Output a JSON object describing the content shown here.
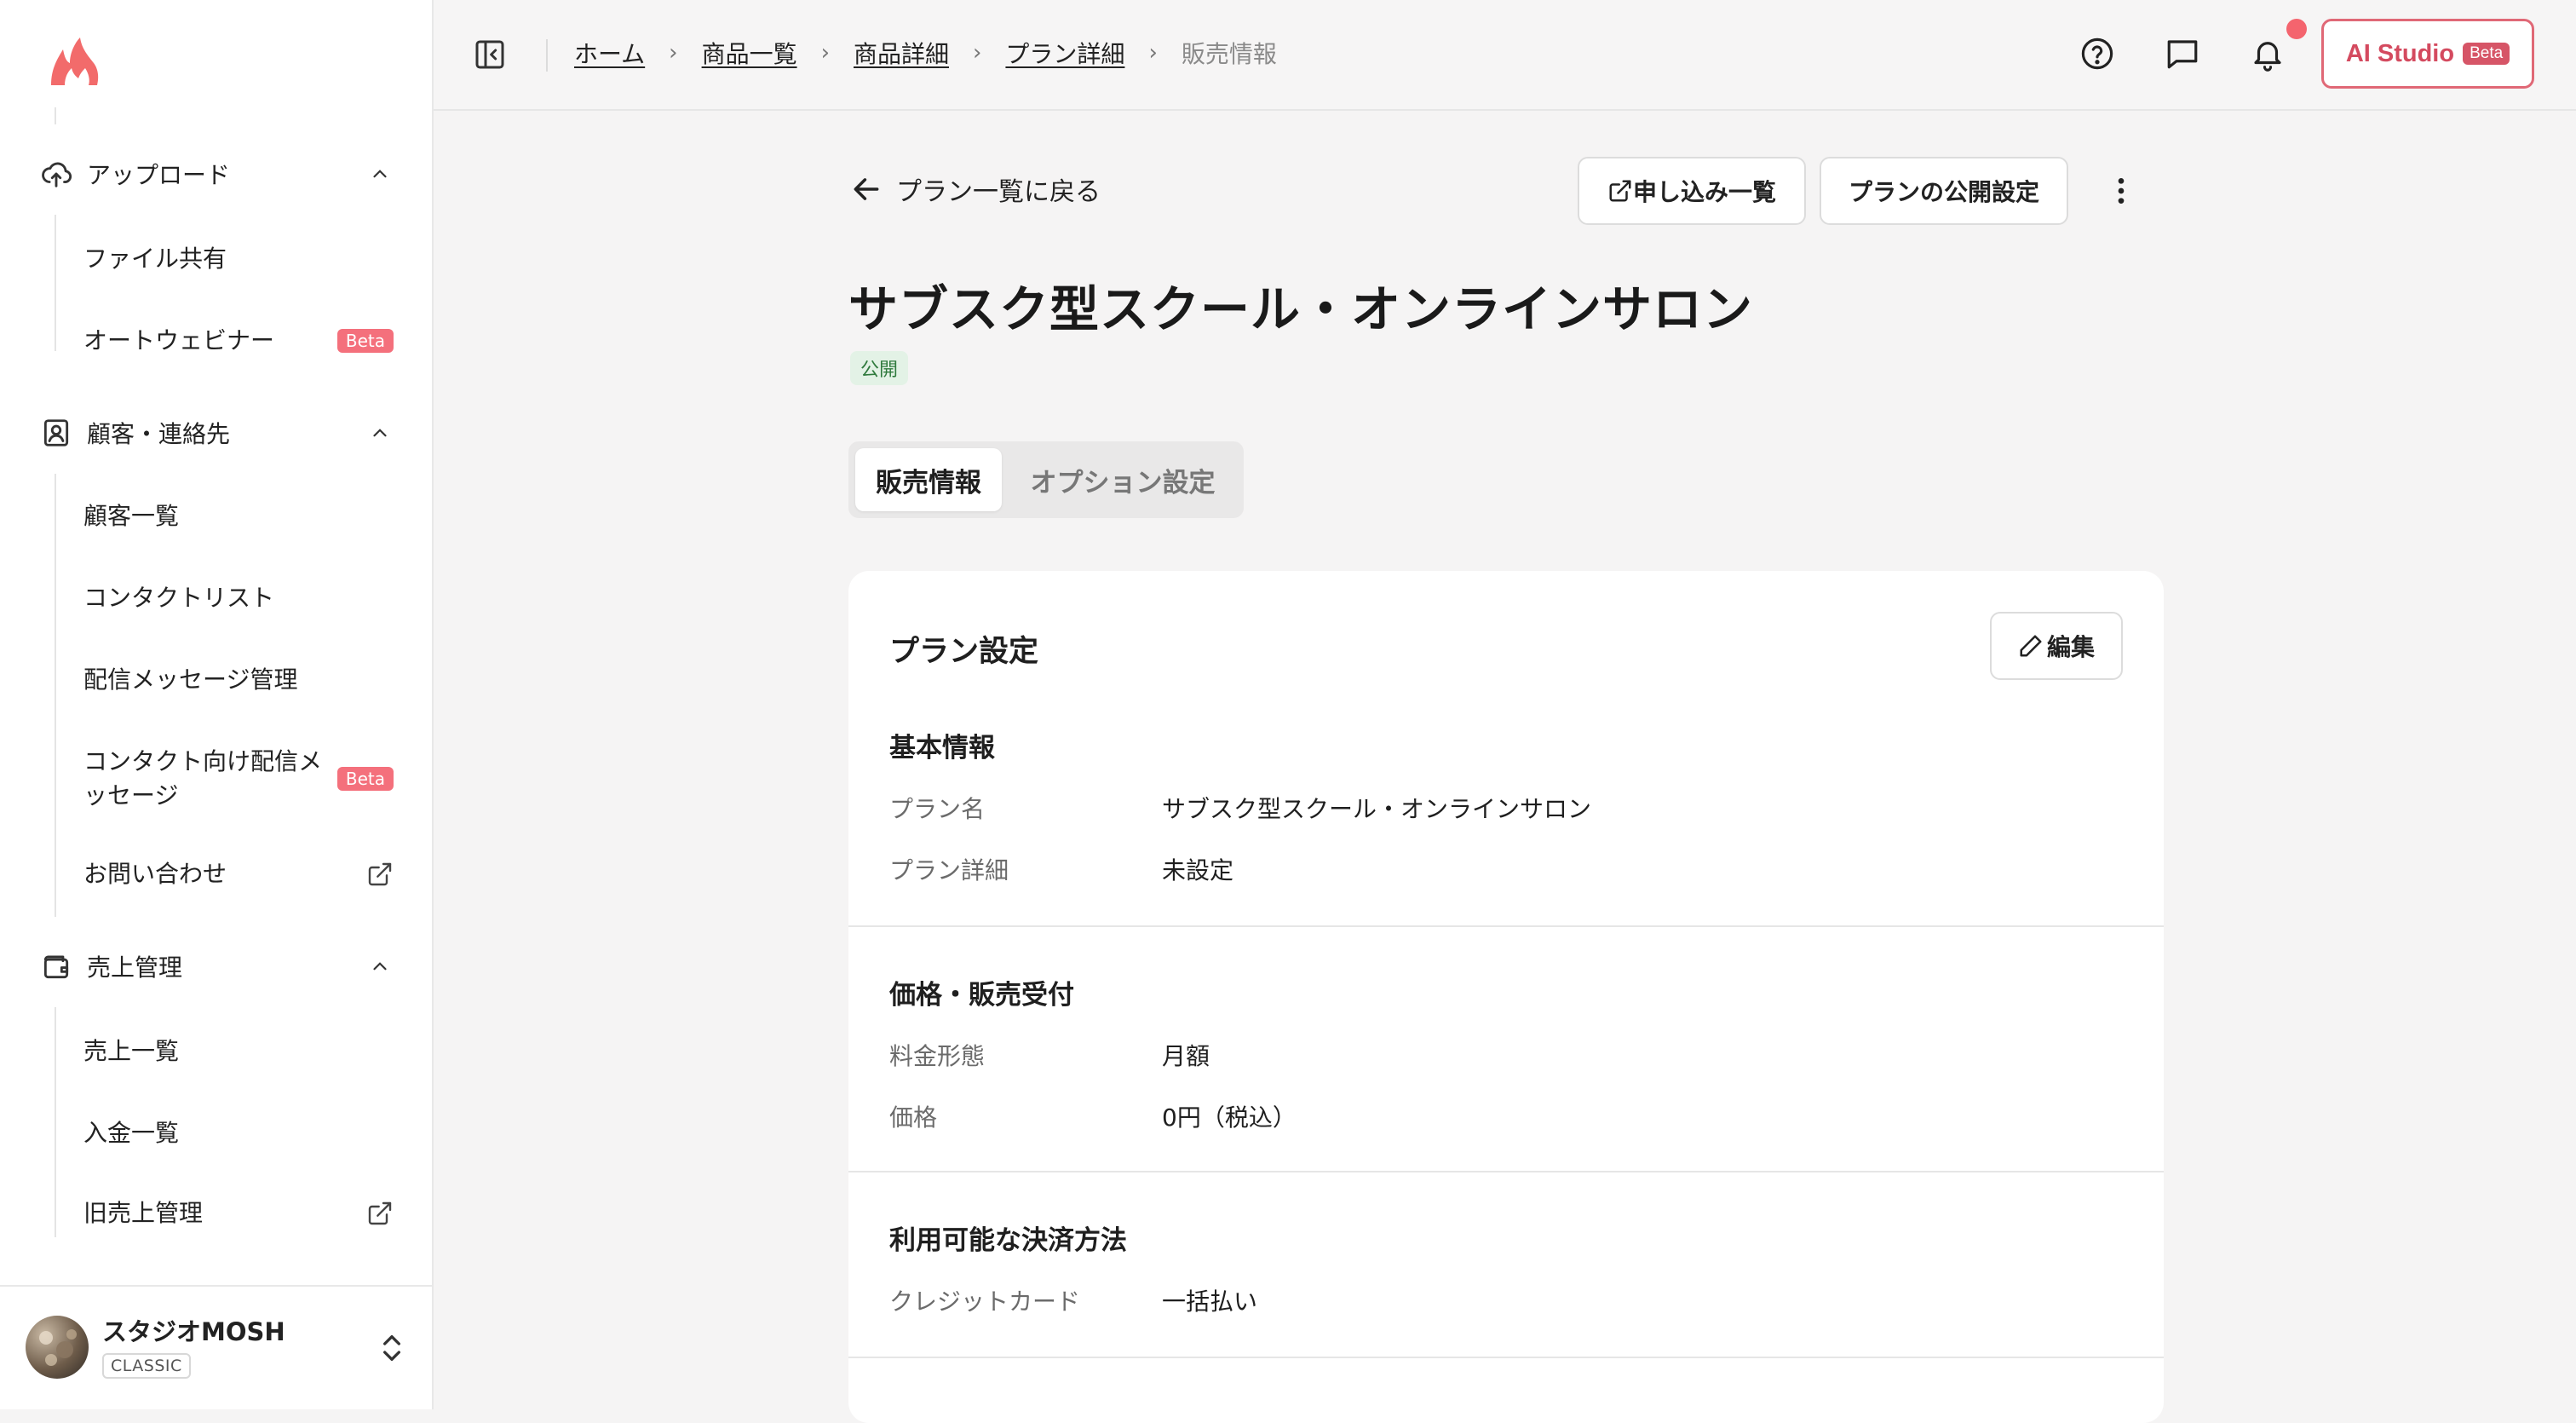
{
  "sidebar": {
    "groups": [
      {
        "label": "アップロード",
        "items": [
          {
            "label": "ファイル共有"
          },
          {
            "label": "オートウェビナー",
            "badge": "Beta"
          }
        ]
      },
      {
        "label": "顧客・連絡先",
        "items": [
          {
            "label": "顧客一覧"
          },
          {
            "label": "コンタクトリスト"
          },
          {
            "label": "配信メッセージ管理"
          },
          {
            "label": "コンタクト向け配信メッセージ",
            "badge": "Beta"
          },
          {
            "label": "お問い合わせ"
          }
        ]
      },
      {
        "label": "売上管理",
        "items": [
          {
            "label": "売上一覧"
          },
          {
            "label": "入金一覧"
          },
          {
            "label": "旧売上管理"
          }
        ]
      }
    ],
    "user": {
      "name": "スタジオMOSH",
      "plan": "CLASSIC"
    }
  },
  "header": {
    "breadcrumb": [
      {
        "label": "ホーム"
      },
      {
        "label": "商品一覧"
      },
      {
        "label": "商品詳細"
      },
      {
        "label": "プラン詳細"
      },
      {
        "label": "販売情報"
      }
    ],
    "ai_studio": {
      "label": "AI Studio",
      "badge": "Beta"
    }
  },
  "main": {
    "back_label": "プラン一覧に戻る",
    "applications_button": "申し込み一覧",
    "publish_settings_button": "プランの公開設定",
    "title": "サブスク型スクール・オンラインサロン",
    "status": "公開",
    "tabs": [
      {
        "label": "販売情報",
        "active": true
      },
      {
        "label": "オプション設定",
        "active": false
      }
    ],
    "card": {
      "title": "プラン設定",
      "edit_label": "編集",
      "sections": [
        {
          "heading": "基本情報",
          "rows": [
            {
              "label": "プラン名",
              "value": "サブスク型スクール・オンラインサロン"
            },
            {
              "label": "プラン詳細",
              "value": "未設定"
            }
          ]
        },
        {
          "heading": "価格・販売受付",
          "rows": [
            {
              "label": "料金形態",
              "value": "月額"
            },
            {
              "label": "価格",
              "value": "0円（税込）"
            }
          ]
        },
        {
          "heading": "利用可能な決済方法",
          "rows": [
            {
              "label": "クレジットカード",
              "value": "一括払い"
            }
          ]
        }
      ]
    }
  },
  "colors": {
    "accent": "#e06876",
    "beta_badge": "#f4707c",
    "status_green_bg": "#e3f2e6",
    "status_green_text": "#2f7a3d",
    "notification_dot": "#f4646e"
  }
}
